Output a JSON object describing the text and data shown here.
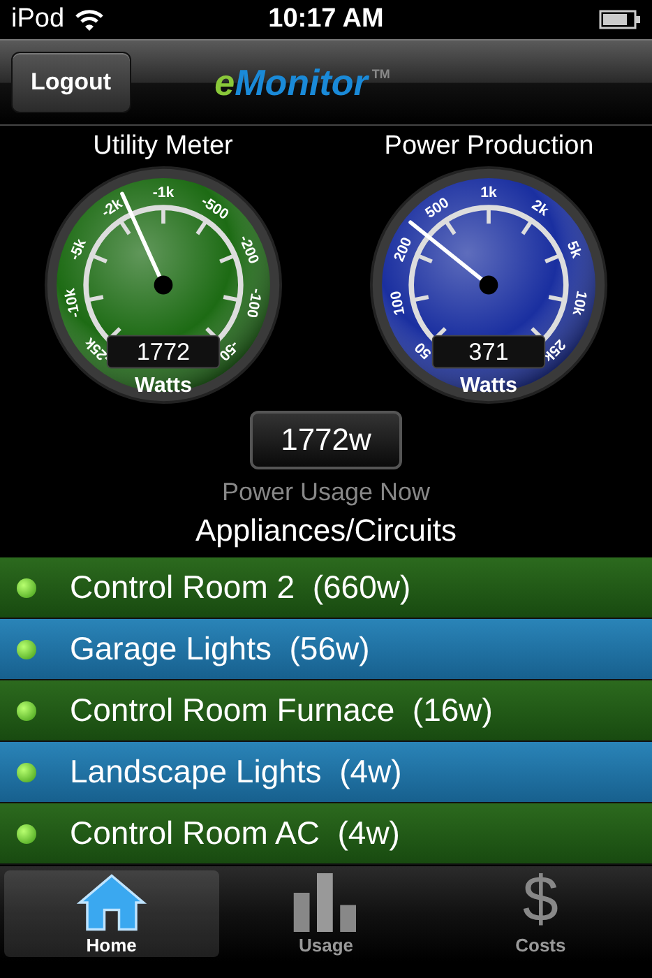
{
  "status_bar": {
    "carrier": "iPod",
    "time": "10:17 AM"
  },
  "nav_bar": {
    "button": "Logout",
    "logo_prefix": "e",
    "logo": "Monitor",
    "trademark": "TM"
  },
  "gauges": [
    {
      "title": "Utility Meter",
      "color": "#1d6b14",
      "ticks": [
        "-25k",
        "-10k",
        "-5k",
        "-2k",
        "-1k",
        "-500",
        "-200",
        "-100",
        "-50"
      ],
      "level": 0.41,
      "reading": "1772",
      "unit": "Watts"
    },
    {
      "title": "Power Production",
      "color": "#1a2fa0",
      "ticks": [
        "50",
        "100",
        "200",
        "500",
        "1k",
        "2k",
        "5k",
        "10k",
        "25k"
      ],
      "level": 0.31,
      "reading": "371",
      "unit": "Watts"
    }
  ],
  "usage_now": {
    "value": "1772w",
    "label": "Power Usage Now"
  },
  "appliances": {
    "title": "Appliances/Circuits",
    "items": [
      {
        "label": "Control Room 2  (660w)"
      },
      {
        "label": "Garage Lights  (56w)"
      },
      {
        "label": "Control Room Furnace  (16w)"
      },
      {
        "label": "Landscape Lights  (4w)"
      },
      {
        "label": "Control Room AC  (4w)"
      }
    ]
  },
  "tabs": [
    {
      "label": "Home",
      "kind": "home",
      "selected": true
    },
    {
      "label": "Usage",
      "kind": "chart",
      "selected": false
    },
    {
      "label": "Costs",
      "kind": "dollar",
      "glyph": "$",
      "selected": false
    }
  ]
}
